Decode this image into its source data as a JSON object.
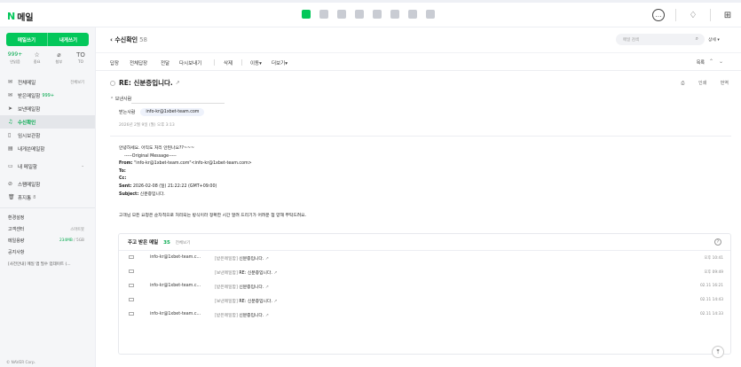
{
  "app": {
    "logo_letter": "N",
    "title": "메일",
    "top_icons": [
      "mail-app-icon",
      "calendar-app-icon",
      "photo-app-icon",
      "contacts-app-icon",
      "cloud-app-icon",
      "memo-app-icon",
      "note-app-icon",
      "bookmark-app-icon"
    ],
    "right_icons": [
      "chat-icon",
      "bell-icon",
      "grid-icon"
    ]
  },
  "sidebar": {
    "compose_label": "메일쓰기",
    "self_label": "내게쓰기",
    "quick": [
      {
        "value": "999+",
        "label": "안읽음"
      },
      {
        "value": "☆",
        "label": "중요"
      },
      {
        "value": "⌀",
        "label": "첨부"
      },
      {
        "value": "TO",
        "label": "TO"
      }
    ],
    "folders": [
      {
        "icon": "✉",
        "label": "전체메일",
        "count": "",
        "side": "전체보기"
      },
      {
        "icon": "✉",
        "label": "받은메일함",
        "count": "999+",
        "side": ""
      },
      {
        "icon": "➤",
        "label": "보낸메일함",
        "count": "",
        "side": ""
      },
      {
        "icon": "♫",
        "label": "수신확인",
        "count": "",
        "side": ""
      },
      {
        "icon": "▯",
        "label": "임시보관함",
        "count": "",
        "side": ""
      },
      {
        "icon": "▤",
        "label": "내게쓴메일함",
        "count": "",
        "side": ""
      }
    ],
    "my_folders": {
      "icon": "▭",
      "label": "내 메일함"
    },
    "spam": {
      "icon": "⊘",
      "label": "스팸메일함"
    },
    "trash": {
      "icon": "🗑",
      "label": "휴지통",
      "count": "8"
    },
    "settings_label": "환경설정",
    "support_label": "고객센터",
    "smart_label": "스마트봇",
    "usage_label": "메일용량",
    "usage_used": "234MB",
    "usage_total": "5GB",
    "notice_label": "공지사항",
    "notice_text": "[사전안내] 메일 앱 필수 업데이트 (...",
    "copyright": "© NAVER Corp."
  },
  "main": {
    "title": "수신확인",
    "count": "58",
    "search_placeholder": "메일 검색",
    "detail_label": "상세",
    "toolbar": [
      "답장",
      "전체답장",
      "전달",
      "다시보내기",
      "삭제",
      "이동",
      "더보기"
    ],
    "list_label": "목록",
    "subject": "RE: 신분증입니다.",
    "print_label": "인쇄",
    "translate_label": "번역",
    "meta_toggle": "보낸사람",
    "sender_label": "받는사람",
    "recipient": "info-kr@1xbet-team.com",
    "date": "2026년 2월 9일 (월) 오후 3:13",
    "body": {
      "line1": "안녕하세요. 아직도 처리 안된나요??~~~",
      "orig": "-----Original Message-----",
      "from_label": "From:",
      "from_value": " \"info-kr@1xbet-team.com\"<info-kr@1xbet-team.com>",
      "to_label": "To:",
      "cc_label": "Cc:",
      "sent_label": "Sent:",
      "sent_value": " 2026-02-08 (일) 21:22:22 (GMT+09:00)",
      "subject_label": "Subject:",
      "subject_value": " 신분증입니다.",
      "closing": "고객님 모든 요청은 순차적으로 처리되는 방식이라 정확한 시간 알려 드리기가 어려운 점 양해 부탁드려요."
    },
    "recent": {
      "title": "주고 받은 메일",
      "count": "35",
      "all_label": "전체보기",
      "help": "?",
      "rows": [
        {
          "from": "info-kr@1xbet-team.c...",
          "folder": "[받은메일함]",
          "subject": "신분증입니다.",
          "time": "오후 10:41"
        },
        {
          "from": "",
          "folder": "[보낸메일함]",
          "subject": "RE: 신분증입니다.",
          "time": "오후 09:49"
        },
        {
          "from": "info-kr@1xbet-team.c...",
          "folder": "[받은메일함]",
          "subject": "신분증입니다.",
          "time": "02.11 16:21"
        },
        {
          "from": "",
          "folder": "[보낸메일함]",
          "subject": "RE: 신분증입니다.",
          "time": "02.11 14:43"
        },
        {
          "from": "info-kr@1xbet-team.c...",
          "folder": "[받은메일함]",
          "subject": "신분증입니다.",
          "time": "02.11 14:33"
        }
      ]
    }
  }
}
